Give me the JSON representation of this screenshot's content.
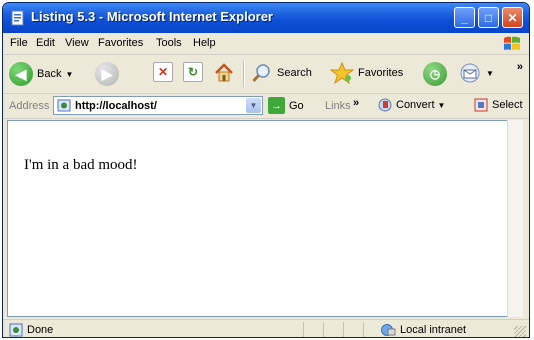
{
  "window": {
    "title": "Listing 5.3 - Microsoft Internet Explorer"
  },
  "menu": {
    "items": [
      "File",
      "Edit",
      "View",
      "Favorites",
      "Tools",
      "Help"
    ]
  },
  "toolbar": {
    "back_label": "Back",
    "search_label": "Search",
    "favorites_label": "Favorites",
    "more_chevron": "»"
  },
  "address_bar": {
    "label": "Address",
    "value": "http://localhost/",
    "go_label": "Go",
    "links_label": "Links",
    "links_chevron": "»",
    "convert_label": "Convert",
    "select_label": "Select"
  },
  "content": {
    "text": "I'm in a bad mood!"
  },
  "status": {
    "left": "Done",
    "zone": "Local intranet"
  },
  "colors": {
    "titlebar": "#0c4fd6",
    "chrome": "#ece9d8",
    "close_button": "#d2441e"
  }
}
